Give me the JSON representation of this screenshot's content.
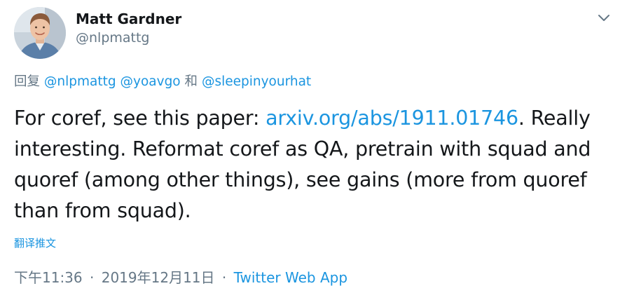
{
  "author": {
    "display_name": "Matt Gardner",
    "handle": "@nlpmattg"
  },
  "reply": {
    "prefix": "回复",
    "mentions": [
      "@nlpmattg",
      "@yoavgo",
      "@sleepinyourhat"
    ],
    "conjunction": "和"
  },
  "tweet": {
    "text_before_link": "For coref, see this paper: ",
    "link": "arxiv.org/abs/1911.01746",
    "text_after_link": ". Really interesting. Reformat coref as QA, pretrain with squad and quoref (among other things), see gains (more from quoref than from squad)."
  },
  "translate_label": "翻译推文",
  "meta": {
    "time": "下午11:36",
    "separator": "·",
    "date": "2019年12月11日",
    "source": "Twitter Web App"
  },
  "icons": {
    "caret": "chevron-down-icon",
    "avatar": "avatar"
  },
  "colors": {
    "link": "#1b95e0",
    "secondary_text": "#657786",
    "primary_text": "#14171a"
  }
}
